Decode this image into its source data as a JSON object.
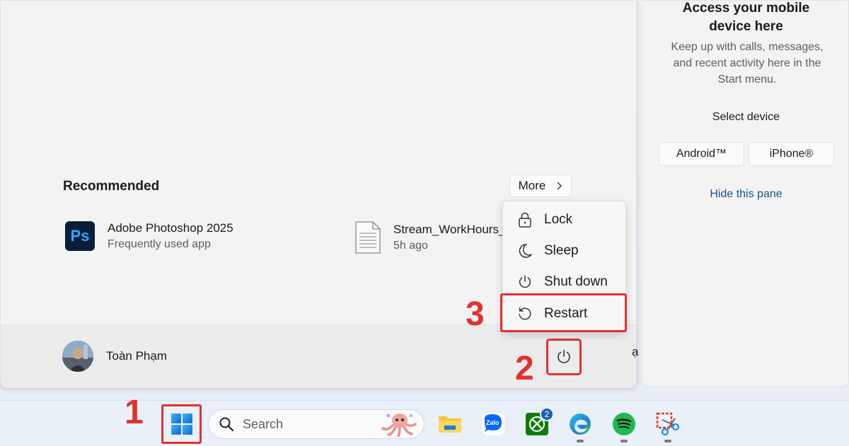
{
  "start_menu": {
    "recommended_title": "Recommended",
    "more_label": "More",
    "items": [
      {
        "name": "Adobe Photoshop 2025",
        "sub": "Frequently used app",
        "icon": "photoshop-icon",
        "icon_text": "Ps"
      },
      {
        "name": "Stream_WorkHours_",
        "sub": "5h ago",
        "icon": "document-icon"
      }
    ],
    "user_name": "Toàn Phạm",
    "edge_fragment": "ạ"
  },
  "power_menu": {
    "items": [
      {
        "label": "Lock",
        "icon": "lock-icon"
      },
      {
        "label": "Sleep",
        "icon": "moon-icon"
      },
      {
        "label": "Shut down",
        "icon": "power-icon"
      },
      {
        "label": "Restart",
        "icon": "restart-icon"
      }
    ]
  },
  "phone_pane": {
    "title_line1": "Access your mobile",
    "title_line2": "device here",
    "desc_line1": "Keep up with calls, messages,",
    "desc_line2": "and recent activity here in the",
    "desc_line3": "Start menu.",
    "select_device": "Select device",
    "android_label": "Android™",
    "iphone_label": "iPhone®",
    "hide_label": "Hide this pane"
  },
  "taskbar": {
    "search_placeholder": "Search",
    "xbox_badge": "2",
    "zalo_label": "Zalo",
    "apps": [
      "start-icon",
      "search-icon",
      "file-explorer-icon",
      "zalo-icon",
      "xbox-icon",
      "edge-icon",
      "spotify-icon",
      "snipping-tool-icon"
    ]
  },
  "annotations": {
    "step1": "1",
    "step2": "2",
    "step3": "3"
  },
  "colors": {
    "highlight": "#e3312e",
    "link": "#1a4e8c",
    "win_blue": "#0f6cbd",
    "spotify": "#1db954",
    "xbox": "#107c10"
  }
}
